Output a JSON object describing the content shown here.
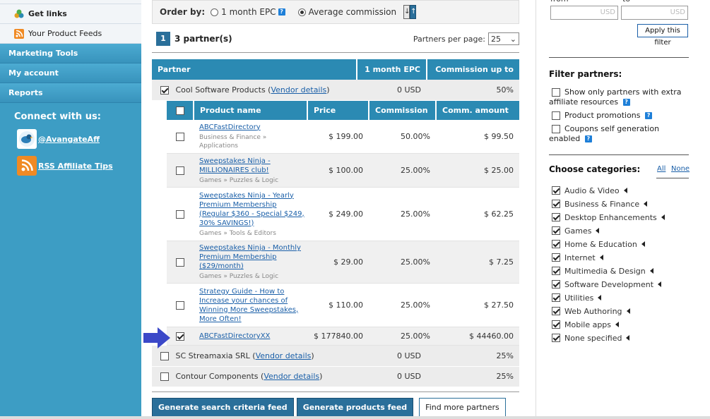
{
  "sidebar": {
    "get_links": "Get links",
    "product_feeds": "Your Product Feeds",
    "sections": [
      "Marketing Tools",
      "My account",
      "Reports"
    ],
    "connect_title": "Connect with us:",
    "twitter": "@AvangateAff",
    "rss": "RSS Affiliate Tips"
  },
  "orderbar": {
    "label": "Order by:",
    "option1": "1 month EPC",
    "option2": "Average commission",
    "selected": "Average commission",
    "sort_desc": "↓",
    "sort_asc": "↑"
  },
  "paging": {
    "page": "1",
    "count_text": "3 partner(s)",
    "per_page_label": "Partners per page:",
    "per_page_value": "25"
  },
  "partner_table": {
    "headers": [
      "Partner",
      "1 month EPC",
      "Commission up to"
    ],
    "vendor_details": "Vendor details",
    "vendors": [
      {
        "name": "Cool Software Products",
        "epc": "0 USD",
        "commission": "50%",
        "checked": true
      },
      {
        "name": "SC Streamaxia SRL",
        "epc": "0 USD",
        "commission": "25%",
        "checked": false
      },
      {
        "name": "Contour Components",
        "epc": "0 USD",
        "commission": "25%",
        "checked": false
      }
    ]
  },
  "product_table": {
    "headers": [
      "Product name",
      "Price",
      "Commission",
      "Comm. amount"
    ],
    "products": [
      {
        "name": "ABCFastDirectory",
        "category": "Business & Finance » Applications",
        "price": "$ 199.00",
        "commission": "50.00%",
        "amount": "$ 99.50",
        "checked": false
      },
      {
        "name": "Sweepstakes Ninja - MILLIONAIRES club!",
        "category": "Games » Puzzles & Logic",
        "price": "$ 100.00",
        "commission": "25.00%",
        "amount": "$ 25.00",
        "checked": false
      },
      {
        "name": "Sweepstakes Ninja - Yearly Premium Membership (Regular $360 - Special $249, 30% SAVINGS!)",
        "category": "Games » Tools & Editors",
        "price": "$ 249.00",
        "commission": "25.00%",
        "amount": "$ 62.25",
        "checked": false
      },
      {
        "name": "Sweepstakes Ninja - Monthly Premium Membership ($29/month)",
        "category": "Games » Puzzles & Logic",
        "price": "$ 29.00",
        "commission": "25.00%",
        "amount": "$ 7.25",
        "checked": false
      },
      {
        "name": "Strategy Guide - How to Increase your chances of Winning More Sweepstakes, More Often!",
        "category": "",
        "price": "$ 110.00",
        "commission": "25.00%",
        "amount": "$ 27.50",
        "checked": false
      },
      {
        "name": "ABCFastDirectoryXX",
        "category": "",
        "price": "$ 177840.00",
        "commission": "25.00%",
        "amount": "$ 44460.00",
        "checked": true
      }
    ]
  },
  "actions": {
    "gen_search": "Generate search criteria feed",
    "gen_products": "Generate products feed",
    "find_more": "Find more partners"
  },
  "right": {
    "from_label": "from",
    "to_label": "to",
    "from_placeholder": "USD",
    "to_placeholder": "USD",
    "apply": "Apply this filter",
    "filter_title": "Filter partners:",
    "filter_options": [
      "Show only partners with extra affiliate resources",
      "Product promotions",
      "Coupons self generation enabled"
    ],
    "categories_title": "Choose categories:",
    "all": "All",
    "none": "None",
    "categories": [
      "Audio & Video",
      "Business & Finance",
      "Desktop Enhancements",
      "Games",
      "Home & Education",
      "Internet",
      "Multimedia & Design",
      "Software Development",
      "Utilities",
      "Web Authoring",
      "Mobile apps",
      "None specified"
    ]
  },
  "colors": {
    "sidebar": "#3d9dc4",
    "header": "#2b8ab3",
    "accent": "#2a6f9a",
    "arrow": "#3b48c8"
  }
}
